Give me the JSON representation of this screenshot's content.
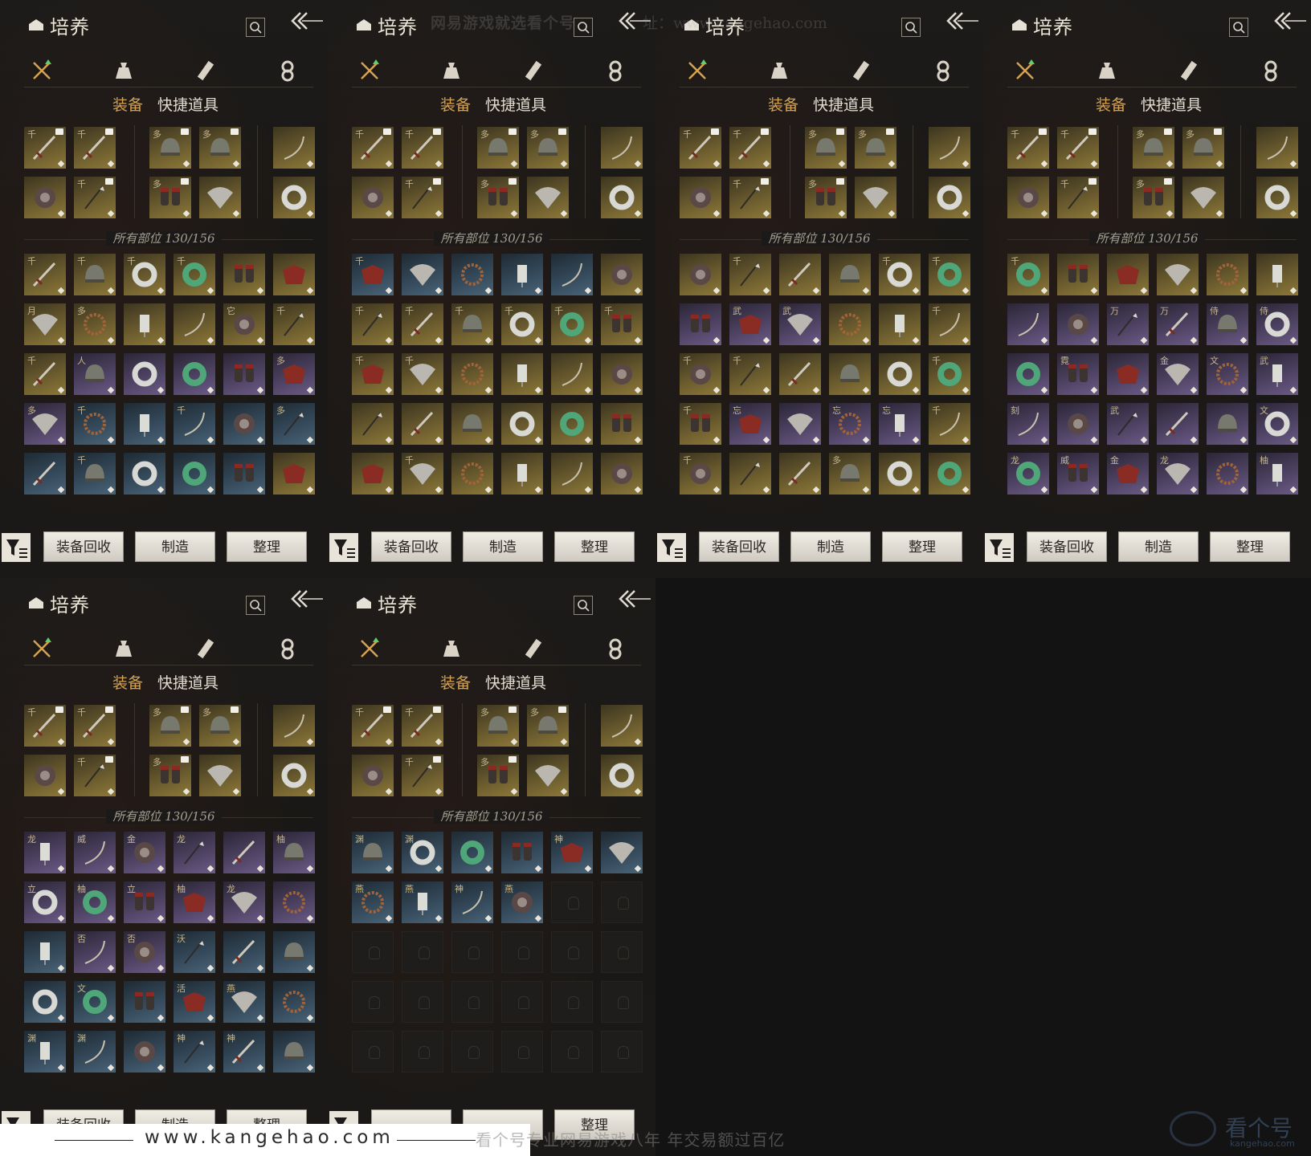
{
  "panels": [
    {
      "title": "培养",
      "subtabs": [
        "装备",
        "快捷道具"
      ],
      "count": "所有部位 130/156",
      "buttons": [
        "装备回收",
        "制造",
        "整理"
      ],
      "bag": [
        [
          "gold:千",
          "gold:千",
          "gold:千",
          "gold:千",
          "gold:",
          "gold:"
        ],
        [
          "gold:月",
          "gold:多",
          "gold:",
          "gold:",
          "gold:它",
          "gold:千"
        ],
        [
          "gold:千",
          "purple:人",
          "purple:",
          "purple:",
          "purple:",
          "purple:多"
        ],
        [
          "purple:多",
          "blue:千",
          "blue:",
          "blue:千",
          "blue:",
          "blue:多"
        ],
        [
          "blue:",
          "blue:千",
          "blue:",
          "blue:",
          "blue:",
          "gold:"
        ]
      ]
    },
    {
      "title": "培养",
      "subtabs": [
        "装备",
        "快捷道具"
      ],
      "count": "所有部位 130/156",
      "buttons": [
        "装备回收",
        "制造",
        "整理"
      ],
      "bag": [
        [
          "blue:千",
          "blue:",
          "blue:",
          "blue:",
          "blue:",
          "gold:"
        ],
        [
          "gold:千",
          "gold:千",
          "gold:千",
          "gold:千",
          "gold:千",
          "gold:千"
        ],
        [
          "gold:千",
          "gold:千",
          "gold:",
          "gold:",
          "gold:",
          "gold:"
        ],
        [
          "gold:",
          "gold:",
          "gold:",
          "gold:",
          "gold:",
          "gold:"
        ],
        [
          "gold:",
          "gold:千",
          "gold:",
          "gold:",
          "gold:",
          "gold:"
        ]
      ]
    },
    {
      "title": "培养",
      "subtabs": [
        "装备",
        "快捷道具"
      ],
      "count": "所有部位 130/156",
      "buttons": [
        "装备回收",
        "制造",
        "整理"
      ],
      "bag": [
        [
          "gold:",
          "gold:千",
          "gold:",
          "gold:",
          "gold:千",
          "gold:千"
        ],
        [
          "purple:",
          "purple:武",
          "purple:武",
          "gold:",
          "gold:",
          "gold:千"
        ],
        [
          "gold:千",
          "gold:千",
          "gold:",
          "gold:",
          "gold:",
          "gold:千"
        ],
        [
          "gold:千",
          "purple:忘",
          "purple:",
          "purple:忘",
          "purple:忘",
          "gold:千"
        ],
        [
          "gold:千",
          "gold:",
          "gold:",
          "gold:多",
          "gold:",
          "gold:"
        ]
      ]
    },
    {
      "title": "培养",
      "subtabs": [
        "装备",
        "快捷道具"
      ],
      "count": "所有部位 130/156",
      "buttons": [
        "装备回收",
        "制造",
        "整理"
      ],
      "bag": [
        [
          "gold:千",
          "gold:",
          "gold:",
          "gold:",
          "gold:",
          "gold:"
        ],
        [
          "purple:",
          "purple:",
          "purple:万",
          "purple:万",
          "purple:侍",
          "purple:侍"
        ],
        [
          "purple:",
          "purple:霓",
          "purple:",
          "purple:金",
          "purple:文",
          "purple:武"
        ],
        [
          "purple:刻",
          "purple:",
          "purple:武",
          "purple:",
          "purple:",
          "purple:文"
        ],
        [
          "purple:龙",
          "purple:威",
          "purple:金",
          "purple:龙",
          "purple:",
          "purple:柚"
        ]
      ]
    },
    {
      "title": "培养",
      "subtabs": [
        "装备",
        "快捷道具"
      ],
      "count": "所有部位 130/156",
      "buttons": [
        "装备回收",
        "制造",
        "整理"
      ],
      "bag": [
        [
          "purple:龙",
          "purple:威",
          "purple:金",
          "purple:龙",
          "purple:",
          "purple:柚"
        ],
        [
          "purple:立",
          "purple:柚",
          "purple:立",
          "purple:柚",
          "purple:龙",
          "purple:"
        ],
        [
          "blue:",
          "purple:否",
          "purple:否",
          "blue:沃",
          "blue:",
          "blue:"
        ],
        [
          "blue:",
          "blue:文",
          "blue:",
          "blue:活",
          "blue:燕",
          "blue:"
        ],
        [
          "blue:渊",
          "blue:渊",
          "blue:",
          "blue:神",
          "blue:神",
          "blue:"
        ]
      ]
    },
    {
      "title": "培养",
      "subtabs": [
        "装备",
        "快捷道具"
      ],
      "count": "所有部位 130/156",
      "buttons": [
        "",
        "",
        "整理"
      ],
      "bag": [
        [
          "blue:渊",
          "blue:渊",
          "blue:",
          "blue:",
          "blue:神",
          "blue:"
        ],
        [
          "blue:燕",
          "blue:燕",
          "blue:神",
          "blue:燕",
          "empty:",
          "empty:"
        ],
        [
          "empty:",
          "empty:",
          "empty:",
          "empty:",
          "empty:",
          "empty:"
        ],
        [
          "empty:",
          "empty:",
          "empty:",
          "empty:",
          "empty:",
          "empty:"
        ],
        [
          "empty:",
          "empty:",
          "empty:",
          "empty:",
          "empty:",
          "empty:"
        ]
      ]
    }
  ],
  "equipped_glyphs": [
    "千",
    "千",
    "多",
    "多",
    "",
    "",
    "千",
    "多",
    "",
    "",
    "",
    "",
    ""
  ],
  "watermarks": {
    "top": "网易游戏就选看个号",
    "top2": "址：www.kangehao.com",
    "url": "www.kangehao.com",
    "center": "看个号专业网易游戏八年  年交易额过百亿",
    "logo": "看个号",
    "logo_sub": "kangehao.com"
  },
  "colors": {
    "accent": "#d6a24f",
    "gold_slot": "#6a5b2e",
    "purple_slot": "#4d4262",
    "blue_slot": "#34495a"
  }
}
